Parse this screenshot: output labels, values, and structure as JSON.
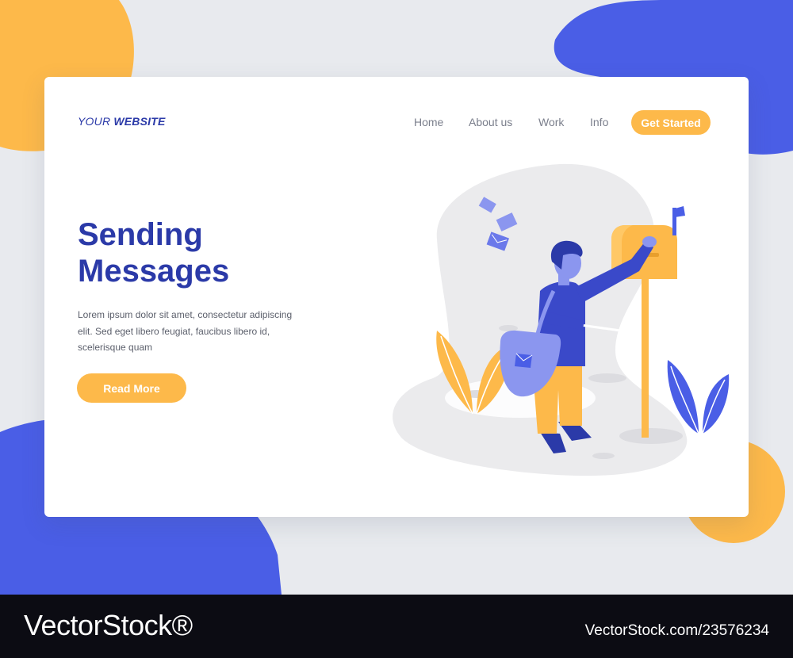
{
  "header": {
    "logo_prefix": "YOUR ",
    "logo_bold": "WEBSITE",
    "nav": [
      "Home",
      "About us",
      "Work",
      "Info"
    ],
    "cta_label": "Get Started"
  },
  "hero": {
    "title_line1": "Sending",
    "title_line2": "Messages",
    "description": "Lorem ipsum dolor sit amet, consectetur adipiscing elit. Sed eget libero feugiat, faucibus libero id, scelerisque quam",
    "button_label": "Read More"
  },
  "watermark": {
    "brand": "VectorStock®",
    "id": "VectorStock.com/23576234"
  },
  "colors": {
    "primary_blue": "#2b3aa8",
    "accent_yellow": "#fdb94a",
    "blob_blue": "#4a5ee6",
    "blob_yellow": "#fdb94a",
    "background": "#e8eaee"
  },
  "icons": [
    "envelope-icon",
    "mailbox-icon",
    "leaf-icon"
  ]
}
